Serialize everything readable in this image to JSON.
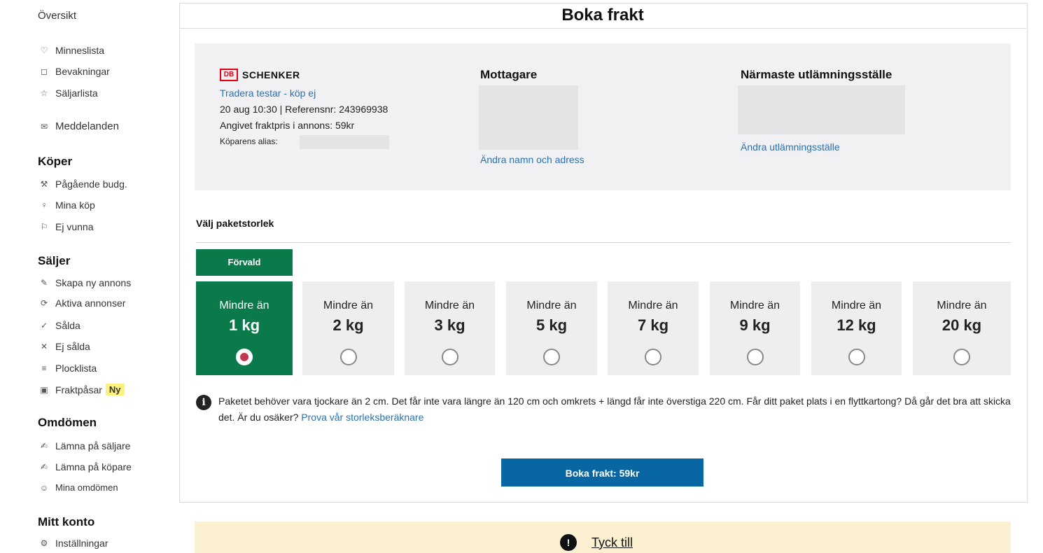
{
  "sidebar": {
    "overview": "Översikt",
    "items_top": [
      {
        "icon": "heart-icon",
        "glyph": "♡",
        "label": "Minneslista"
      },
      {
        "icon": "bookmark-icon",
        "glyph": "◻",
        "label": "Bevakningar"
      },
      {
        "icon": "star-icon",
        "glyph": "☆",
        "label": "Säljarlista"
      },
      {
        "icon": "mail-icon",
        "glyph": "✉",
        "label": "Meddelanden"
      }
    ],
    "buyer_heading": "Köper",
    "buyer_items": [
      {
        "icon": "gavel-icon",
        "glyph": "⚒",
        "label": "Pågående budg."
      },
      {
        "icon": "bag-icon",
        "glyph": "♀",
        "label": "Mina köp"
      },
      {
        "icon": "lost-icon",
        "glyph": "⚐",
        "label": "Ej vunna"
      }
    ],
    "seller_heading": "Säljer",
    "seller_items": [
      {
        "icon": "pencil-icon",
        "glyph": "✎",
        "label": "Skapa ny annons"
      },
      {
        "icon": "tag-icon",
        "glyph": "⟳",
        "label": "Aktiva annonser"
      },
      {
        "icon": "check-icon",
        "glyph": "✓",
        "label": "Sålda"
      },
      {
        "icon": "cross-icon",
        "glyph": "✕",
        "label": "Ej sålda"
      },
      {
        "icon": "list-icon",
        "glyph": "≡",
        "label": "Plocklista"
      },
      {
        "icon": "package-icon",
        "glyph": "▣",
        "label": "Fraktpåsar",
        "badge": "Ny"
      }
    ],
    "reviews_heading": "Omdömen",
    "reviews_items": [
      {
        "icon": "edit-icon",
        "glyph": "✍",
        "label": "Lämna på säljare"
      },
      {
        "icon": "edit-icon",
        "glyph": "✍",
        "label": "Lämna på köpare"
      },
      {
        "icon": "smile-icon",
        "glyph": "☺",
        "label": "Mina omdömen"
      }
    ],
    "account_heading": "Mitt konto",
    "account_items": [
      {
        "icon": "gear-icon",
        "glyph": "⚙",
        "label": "Inställningar"
      }
    ]
  },
  "page_title": "Boka frakt",
  "shipment": {
    "carrier_logo_db": "DB",
    "carrier_name": "SCHENKER",
    "item_link": "Tradera testar - köp ej",
    "date_ref": "20 aug 10:30 | Referensnr: 243969938",
    "price_note": "Angivet fraktpris i annons: 59kr",
    "alias_label": "Köparens alias:"
  },
  "recipient": {
    "title": "Mottagare",
    "change_link": "Ändra namn och adress"
  },
  "pickup": {
    "title": "Närmaste utlämningsställe",
    "change_link": "Ändra utlämningsställe"
  },
  "package": {
    "heading": "Välj paketstorlek",
    "default_tag": "Förvald",
    "options": [
      {
        "prefix": "Mindre än",
        "size": "1 kg",
        "selected": true
      },
      {
        "prefix": "Mindre än",
        "size": "2 kg",
        "selected": false
      },
      {
        "prefix": "Mindre än",
        "size": "3 kg",
        "selected": false
      },
      {
        "prefix": "Mindre än",
        "size": "5 kg",
        "selected": false
      },
      {
        "prefix": "Mindre än",
        "size": "7 kg",
        "selected": false
      },
      {
        "prefix": "Mindre än",
        "size": "9 kg",
        "selected": false
      },
      {
        "prefix": "Mindre än",
        "size": "12 kg",
        "selected": false
      },
      {
        "prefix": "Mindre än",
        "size": "20 kg",
        "selected": false
      }
    ]
  },
  "notice": {
    "text": "Paketet behöver vara tjockare än 2 cm. Det får inte vara längre än 120 cm och omkrets + längd får inte överstiga 220 cm. Får ditt paket plats i en flyttkartong? Då går det bra att skicka det. Är du osäker? ",
    "link": "Prova vår storleksberäknare"
  },
  "book_button": "Boka frakt: 59kr",
  "feedback": {
    "label": "Tyck till"
  },
  "colors": {
    "selected_green": "#0b7a4b",
    "button_blue": "#0867a3",
    "link_blue": "#2a6fb0",
    "feedback_bg": "#fbf1d1"
  }
}
